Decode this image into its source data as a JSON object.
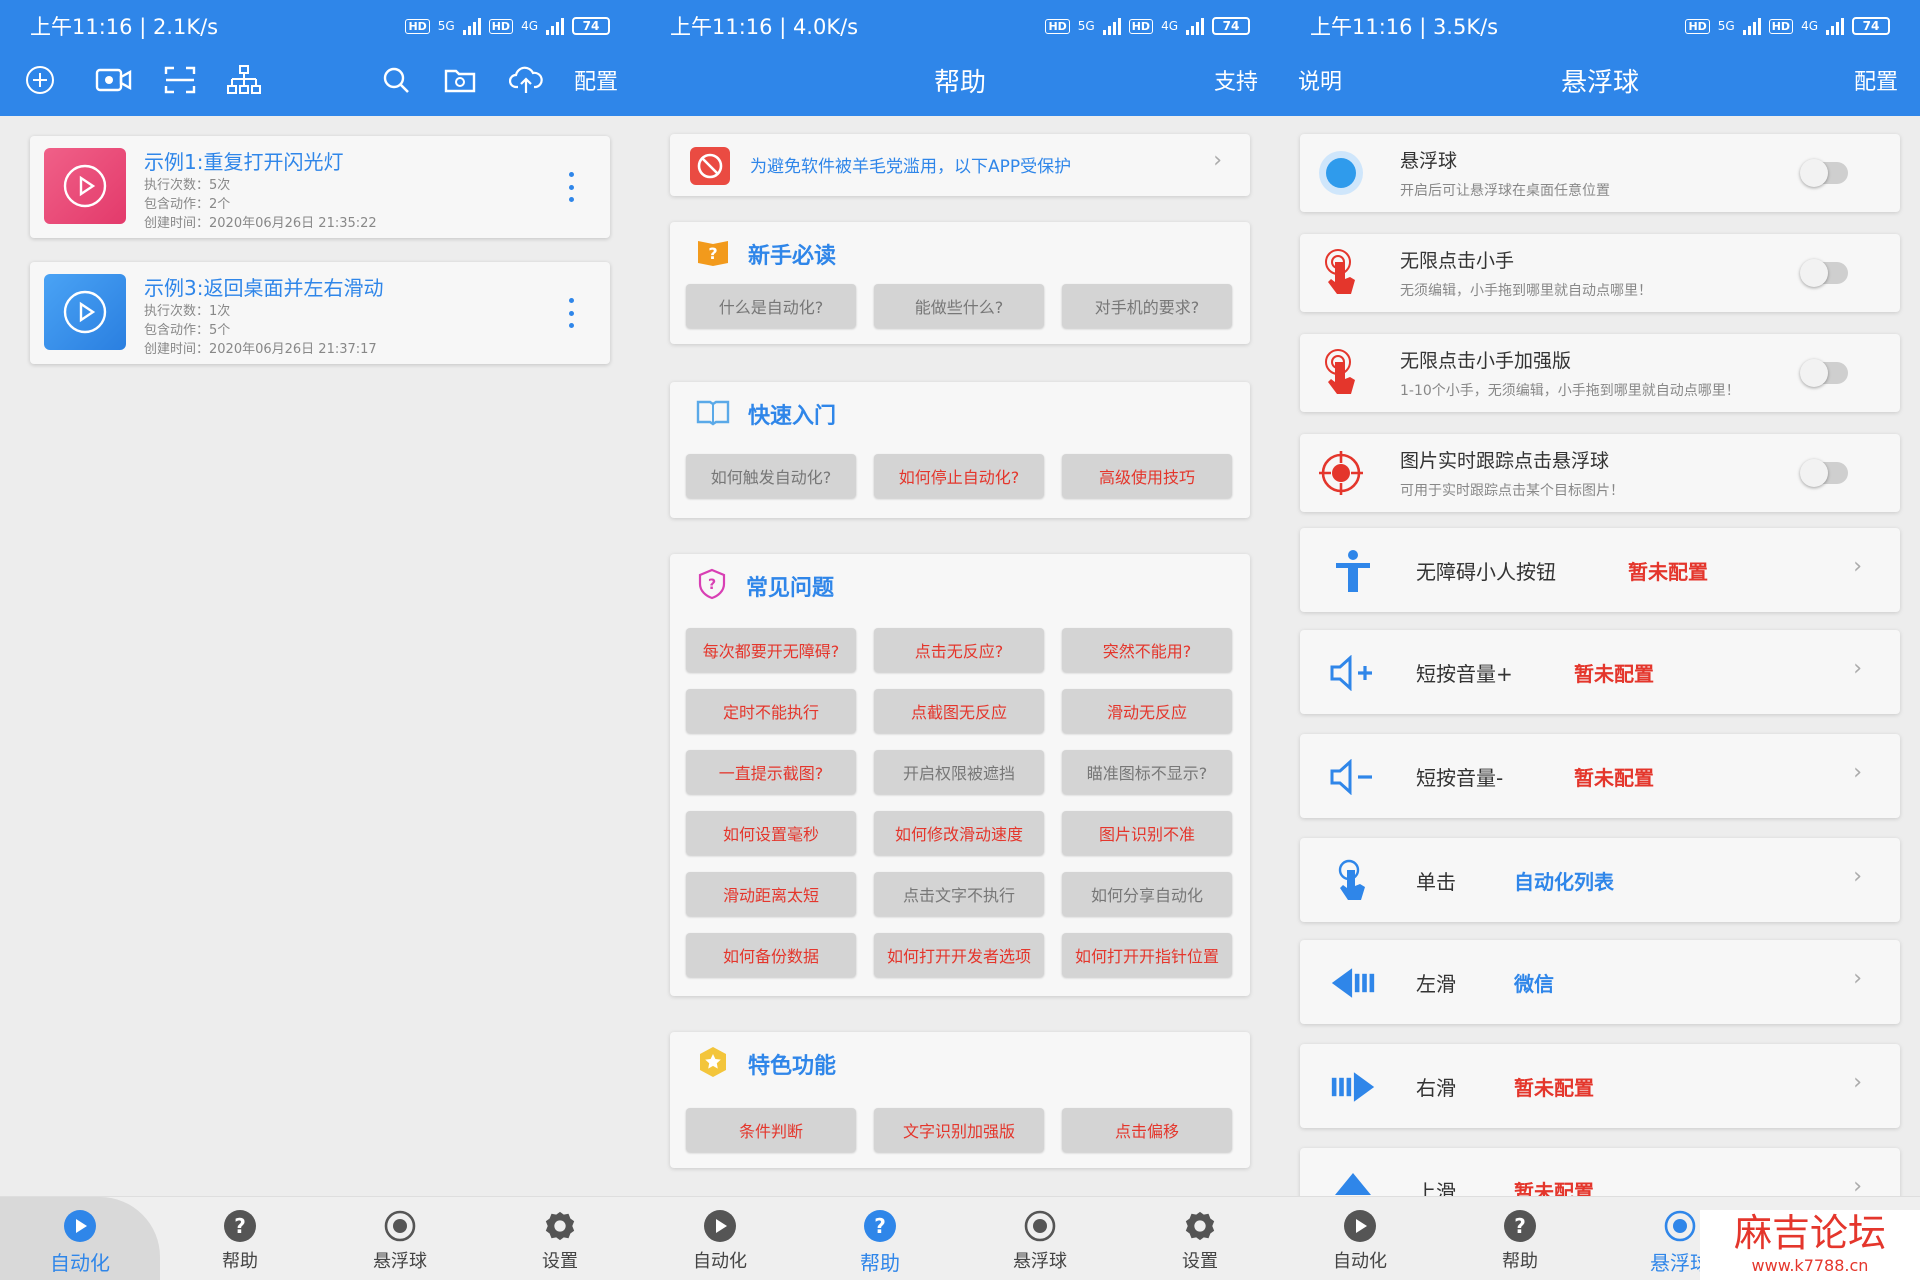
{
  "colors": {
    "primary": "#2f86e9",
    "accent_red": "#e4362c"
  },
  "status_bars": [
    {
      "left": "上午11:16 | 2.1K/s",
      "battery": "74",
      "net1": "5G",
      "net2": "4G"
    },
    {
      "left": "上午11:16 | 4.0K/s",
      "battery": "74",
      "net1": "5G",
      "net2": "4G"
    },
    {
      "left": "上午11:16 | 3.5K/s",
      "battery": "74",
      "net1": "5G",
      "net2": "4G"
    }
  ],
  "panel1": {
    "toolbar_icons": [
      "add-circle-icon",
      "video-record-icon",
      "scan-icon",
      "hierarchy-icon",
      "search-icon",
      "folder-icon",
      "cloud-upload-icon"
    ],
    "config_label": "配置",
    "tasks": [
      {
        "title": "示例1:重复打开闪光灯",
        "runs": "执行次数：5次",
        "actions": "包含动作：2个",
        "created": "创建时间：2020年06月26日 21:35:22"
      },
      {
        "title": "示例3:返回桌面并左右滑动",
        "runs": "执行次数：1次",
        "actions": "包含动作：5个",
        "created": "创建时间：2020年06月26日 21:37:17"
      }
    ]
  },
  "panel2": {
    "title": "帮助",
    "support_label": "支持",
    "banner": "为避免软件被羊毛党滥用，以下APP受保护",
    "sections": [
      {
        "title": "新手必读",
        "icon": "book-question-icon",
        "chips": [
          {
            "label": "什么是自动化?",
            "tone": "gray"
          },
          {
            "label": "能做些什么?",
            "tone": "gray"
          },
          {
            "label": "对手机的要求?",
            "tone": "gray"
          }
        ]
      },
      {
        "title": "快速入门",
        "icon": "open-book-icon",
        "chips": [
          {
            "label": "如何触发自动化?",
            "tone": "gray"
          },
          {
            "label": "如何停止自动化?",
            "tone": "red"
          },
          {
            "label": "高级使用技巧",
            "tone": "red"
          }
        ]
      },
      {
        "title": "常见问题",
        "icon": "question-shield-icon",
        "chips": [
          {
            "label": "每次都要开无障碍?",
            "tone": "red"
          },
          {
            "label": "点击无反应?",
            "tone": "red"
          },
          {
            "label": "突然不能用?",
            "tone": "red"
          },
          {
            "label": "定时不能执行",
            "tone": "red"
          },
          {
            "label": "点截图无反应",
            "tone": "red"
          },
          {
            "label": "滑动无反应",
            "tone": "red"
          },
          {
            "label": "一直提示截图?",
            "tone": "red"
          },
          {
            "label": "开启权限被遮挡",
            "tone": "gray"
          },
          {
            "label": "瞄准图标不显示?",
            "tone": "gray"
          },
          {
            "label": "如何设置毫秒",
            "tone": "red"
          },
          {
            "label": "如何修改滑动速度",
            "tone": "red"
          },
          {
            "label": "图片识别不准",
            "tone": "red"
          },
          {
            "label": "滑动距离太短",
            "tone": "red"
          },
          {
            "label": "点击文字不执行",
            "tone": "gray"
          },
          {
            "label": "如何分享自动化",
            "tone": "gray"
          },
          {
            "label": "如何备份数据",
            "tone": "red"
          },
          {
            "label": "如何打开开发者选项",
            "tone": "red"
          },
          {
            "label": "如何打开开指针位置",
            "tone": "red"
          }
        ]
      },
      {
        "title": "特色功能",
        "icon": "star-badge-icon",
        "chips": [
          {
            "label": "条件判断",
            "tone": "red"
          },
          {
            "label": "文字识别加强版",
            "tone": "red"
          },
          {
            "label": "点击偏移",
            "tone": "red"
          }
        ]
      }
    ]
  },
  "panel3": {
    "title": "悬浮球",
    "left_label": "说明",
    "right_label": "配置",
    "toggles": [
      {
        "title": "悬浮球",
        "sub": "开启后可让悬浮球在桌面任意位置",
        "icon": "floating-ball-icon"
      },
      {
        "title": "无限点击小手",
        "sub": "无须编辑，小手拖到哪里就自动点哪里！",
        "icon": "tap-hand-icon"
      },
      {
        "title": "无限点击小手加强版",
        "sub": "1-10个小手，无须编辑，小手拖到哪里就自动点哪里！",
        "icon": "tap-hand-icon"
      },
      {
        "title": "图片实时跟踪点击悬浮球",
        "sub": "可用于实时跟踪点击某个目标图片！",
        "icon": "target-icon"
      }
    ],
    "actions": [
      {
        "label": "无障碍小人按钮",
        "value": "暂未配置",
        "tone": "red",
        "icon": "accessibility-icon"
      },
      {
        "label": "短按音量+",
        "value": "暂未配置",
        "tone": "red",
        "icon": "volume-up-icon"
      },
      {
        "label": "短按音量-",
        "value": "暂未配置",
        "tone": "red",
        "icon": "volume-down-icon"
      },
      {
        "label": "单击",
        "value": "自动化列表",
        "tone": "blue",
        "icon": "single-tap-icon"
      },
      {
        "label": "左滑",
        "value": "微信",
        "tone": "blue",
        "icon": "swipe-left-icon"
      },
      {
        "label": "右滑",
        "value": "暂未配置",
        "tone": "red",
        "icon": "swipe-right-icon"
      },
      {
        "label": "上滑",
        "value": "暂未配置",
        "tone": "red",
        "icon": "swipe-up-icon"
      }
    ]
  },
  "bottom_nav": [
    {
      "label": "自动化",
      "icon": "play-circle-icon"
    },
    {
      "label": "帮助",
      "icon": "help-circle-icon"
    },
    {
      "label": "悬浮球",
      "icon": "float-ball-icon"
    },
    {
      "label": "设置",
      "icon": "gear-icon"
    }
  ],
  "bottom_nav_p3_third": "悬浮球",
  "watermark": {
    "name": "麻吉论坛",
    "url": "www.k7788.cn"
  }
}
